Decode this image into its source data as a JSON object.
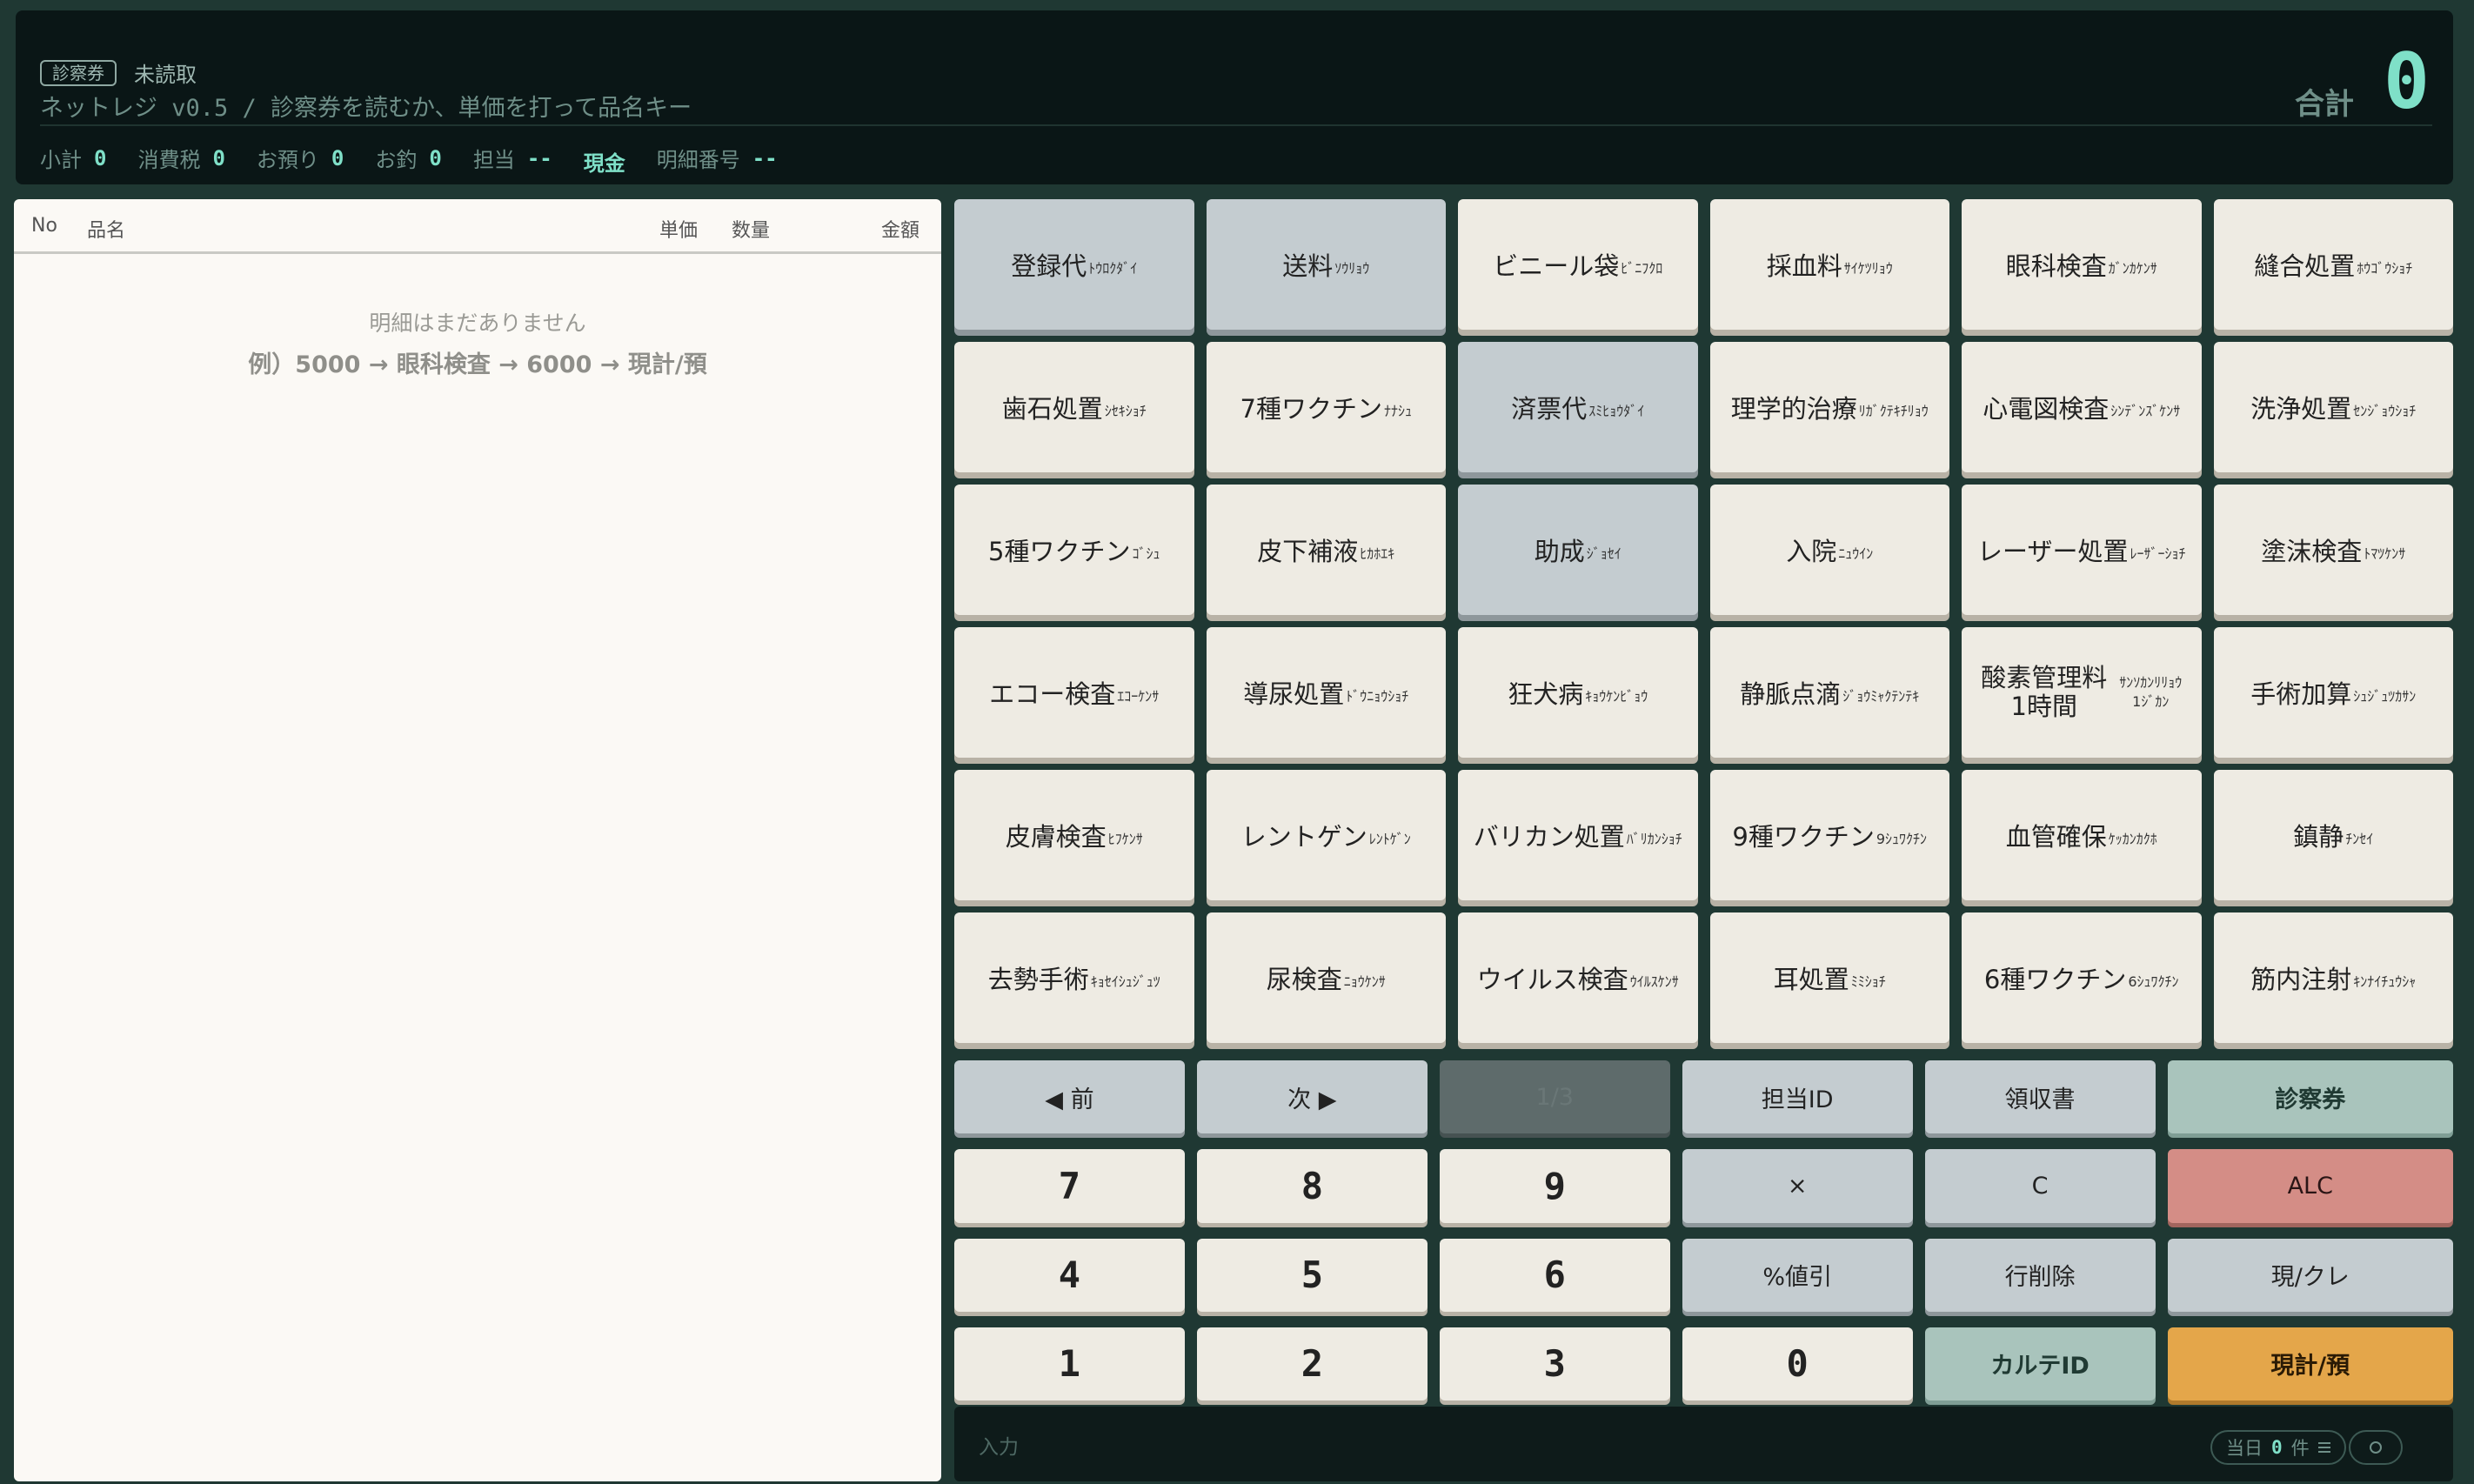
{
  "header": {
    "badge": "診察券",
    "badge_status": "未読取",
    "title": "ネットレジ v0.5  /  診察券を読むか、単価を打って品名キー",
    "total_label": "合計",
    "total_value": "0",
    "stats": {
      "subtotal_label": "小計",
      "subtotal": "0",
      "tax_label": "消費税",
      "tax": "0",
      "deposit_label": "お預り",
      "deposit": "0",
      "change_label": "お釣",
      "change": "0",
      "staff_label": "担当",
      "staff": "--",
      "payment_mode": "現金",
      "detail_label": "明細番号",
      "detail_no": "--"
    }
  },
  "receipt": {
    "columns": {
      "no": "No",
      "name": "品名",
      "unit_price": "単価",
      "qty": "数量",
      "amount": "金額"
    },
    "empty_message": "明細はまだありません",
    "example": "例）5000 → 眼科検査 → 6000 → 現計/預"
  },
  "items": [
    {
      "name": "登録代",
      "kana": "ﾄｳﾛｸﾀﾞｲ"
    },
    {
      "name": "送料",
      "kana": "ｿｳﾘｮｳ"
    },
    {
      "name": "ビニール袋",
      "kana": "ﾋﾞﾆﾌｸﾛ"
    },
    {
      "name": "採血料",
      "kana": "ｻｲｹﾂﾘｮｳ"
    },
    {
      "name": "眼科検査",
      "kana": "ｶﾞﾝｶｹﾝｻ"
    },
    {
      "name": "縫合処置",
      "kana": "ﾎｳｺﾞｳｼｮﾁ"
    },
    {
      "name": "歯石処置",
      "kana": "ｼｾｷｼｮﾁ"
    },
    {
      "name": "7種ワクチン",
      "kana": "ﾅﾅｼｭ"
    },
    {
      "name": "済票代",
      "kana": "ｽﾐﾋｮｳﾀﾞｲ"
    },
    {
      "name": "理学的治療",
      "kana": "ﾘｶﾞｸﾃｷﾁﾘｮｳ"
    },
    {
      "name": "心電図検査",
      "kana": "ｼﾝﾃﾞﾝｽﾞｹﾝｻ"
    },
    {
      "name": "洗浄処置",
      "kana": "ｾﾝｼﾞｮｳｼｮﾁ"
    },
    {
      "name": "5種ワクチン",
      "kana": "ｺﾞｼｭ"
    },
    {
      "name": "皮下補液",
      "kana": "ﾋｶﾎｴｷ"
    },
    {
      "name": "助成",
      "kana": "ｼﾞｮｾｲ"
    },
    {
      "name": "入院",
      "kana": "ﾆｭｳｲﾝ"
    },
    {
      "name": "レーザー処置",
      "kana": "ﾚｰｻﾞｰｼｮﾁ"
    },
    {
      "name": "塗沫検査",
      "kana": "ﾄﾏﾂｹﾝｻ"
    },
    {
      "name": "エコー検査",
      "kana": "ｴｺｰｹﾝｻ"
    },
    {
      "name": "導尿処置",
      "kana": "ﾄﾞｳﾆｮｳｼｮﾁ"
    },
    {
      "name": "狂犬病",
      "kana": "ｷｮｳｹﾝﾋﾞｮｳ"
    },
    {
      "name": "静脈点滴",
      "kana": "ｼﾞｮｳﾐｬｸﾃﾝﾃｷ"
    },
    {
      "name": "酸素管理料",
      "name2": "1時間",
      "kana": "ｻﾝｿｶﾝﾘﾘｮｳ",
      "kana2": "1ｼﾞｶﾝ"
    },
    {
      "name": "手術加算",
      "kana": "ｼｭｼﾞｭﾂｶｻﾝ"
    },
    {
      "name": "皮膚検査",
      "kana": "ﾋﾌｹﾝｻ"
    },
    {
      "name": "レントゲン",
      "kana": "ﾚﾝﾄｹﾞﾝ"
    },
    {
      "name": "バリカン処置",
      "kana": "ﾊﾞﾘｶﾝｼｮﾁ"
    },
    {
      "name": "9種ワクチン",
      "kana": "9ｼｭﾜｸﾁﾝ"
    },
    {
      "name": "血管確保",
      "kana": "ｹｯｶﾝｶｸﾎ"
    },
    {
      "name": "鎮静",
      "kana": "ﾁﾝｾｲ"
    },
    {
      "name": "去勢手術",
      "kana": "ｷｮｾｲｼｭｼﾞｭﾂ"
    },
    {
      "name": "尿検査",
      "kana": "ﾆｮｳｹﾝｻ"
    },
    {
      "name": "ウイルス検査",
      "kana": "ｳｲﾙｽｹﾝｻ"
    },
    {
      "name": "耳処置",
      "kana": "ﾐﾐｼｮﾁ"
    },
    {
      "name": "6種ワクチン",
      "kana": "6ｼｭﾜｸﾁﾝ"
    },
    {
      "name": "筋内注射",
      "kana": "ｷﾝﾅｲﾁｭｳｼｬ"
    }
  ],
  "controls": {
    "prev": "◀ 前",
    "next": "次 ▶",
    "page": "1/3",
    "staff_id": "担当ID",
    "receipt": "領収書",
    "card": "診察券",
    "seven": "7",
    "eight": "8",
    "nine": "9",
    "multiply": "×",
    "clear": "C",
    "all_clear": "ALC",
    "four": "4",
    "five": "5",
    "six": "6",
    "discount": "%値引",
    "delete_line": "行削除",
    "cash_credit": "現/クレ",
    "one": "1",
    "two": "2",
    "three": "3",
    "zero": "0",
    "chart_id": "カルテID",
    "tender": "現計/預"
  },
  "input_bar": {
    "label": "入力",
    "count_prefix": "当日",
    "count": "0",
    "count_suffix": "件"
  },
  "colors": {
    "accent": "#7fe0c8",
    "key_cream": "#eeebe3",
    "key_grey": "#c4ccd0",
    "key_teal": "#a9c4bc",
    "key_red": "#d48d86",
    "key_orange": "#e4a64a"
  }
}
